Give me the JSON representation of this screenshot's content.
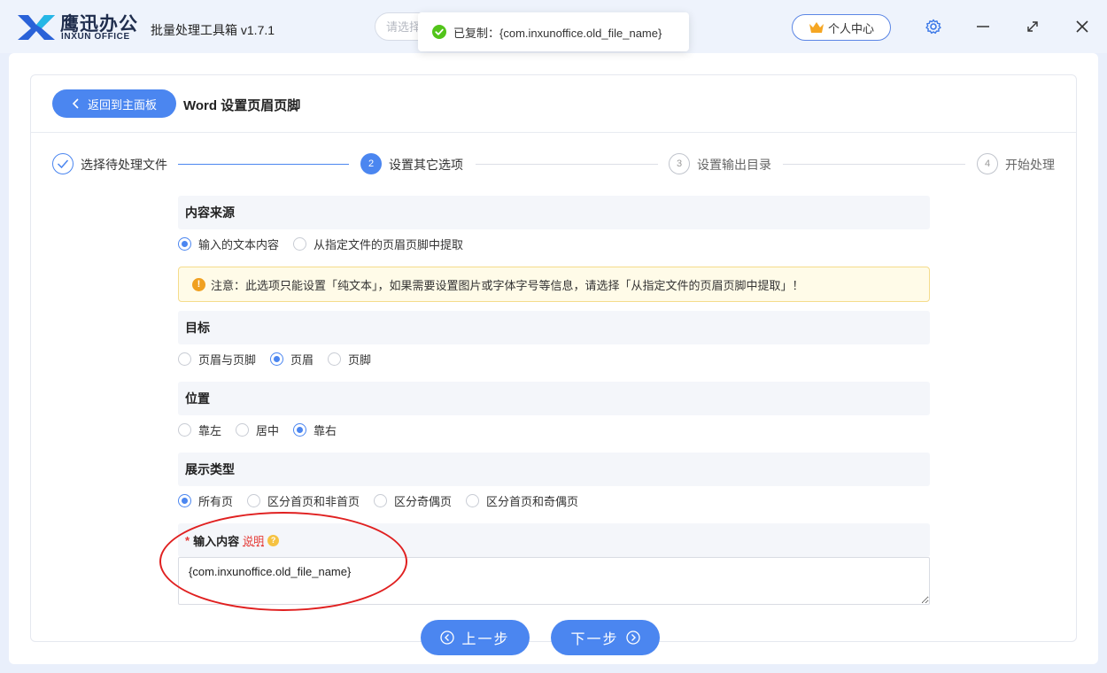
{
  "app": {
    "brand_cn": "鹰迅办公",
    "brand_en": "INXUN OFFICE",
    "name": "批量处理工具箱 v1.7.1",
    "search_placeholder": "请选择",
    "vip_label": "个人中心"
  },
  "toast": {
    "text": "已复制：{com.inxunoffice.old_file_name}"
  },
  "header": {
    "back_label": "返回到主面板",
    "title": "Word 设置页眉页脚"
  },
  "steps": [
    {
      "num": "✓",
      "label": "选择待处理文件",
      "state": "done"
    },
    {
      "num": "2",
      "label": "设置其它选项",
      "state": "active"
    },
    {
      "num": "3",
      "label": "设置输出目录",
      "state": "pending"
    },
    {
      "num": "4",
      "label": "开始处理",
      "state": "pending"
    }
  ],
  "sections": {
    "source": {
      "title": "内容来源",
      "options": [
        "输入的文本内容",
        "从指定文件的页眉页脚中提取"
      ],
      "selected": 0
    },
    "notice": "注意：此选项只能设置「纯文本」，如果需要设置图片或字体字号等信息，请选择「从指定文件的页眉页脚中提取」！",
    "target": {
      "title": "目标",
      "options": [
        "页眉与页脚",
        "页眉",
        "页脚"
      ],
      "selected": 1
    },
    "position": {
      "title": "位置",
      "options": [
        "靠左",
        "居中",
        "靠右"
      ],
      "selected": 2
    },
    "display": {
      "title": "展示类型",
      "options": [
        "所有页",
        "区分首页和非首页",
        "区分奇偶页",
        "区分首页和奇偶页"
      ],
      "selected": 0
    },
    "input": {
      "required_mark": "*",
      "title": "输入内容",
      "help_label": "说明",
      "value": "{com.inxunoffice.old_file_name}"
    }
  },
  "footer": {
    "prev_label": "上一步",
    "next_label": "下一步"
  },
  "colors": {
    "accent": "#4b86f0",
    "annotation": "#e02020"
  }
}
